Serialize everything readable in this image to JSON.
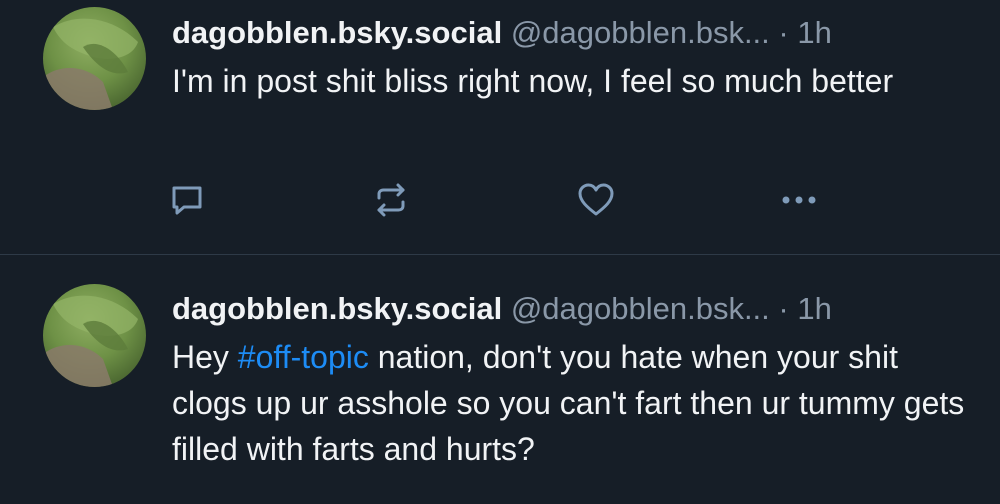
{
  "posts": [
    {
      "display_name": "dagobblen.bsky.social",
      "handle": "@dagobblen.bsk...",
      "separator": "·",
      "time": "1h",
      "text": "I'm in post shit bliss right now, I feel so much better",
      "actions": [
        "reply-icon",
        "repost-icon",
        "like-icon",
        "more-icon"
      ]
    },
    {
      "display_name": "dagobblen.bsky.social",
      "handle": "@dagobblen.bsk...",
      "separator": "·",
      "time": "1h",
      "text_before": "Hey ",
      "hashtag": "#off-topic",
      "text_after": " nation, don't you hate when your shit clogs up ur asshole so you can't fart then ur tummy gets filled with farts and hurts?"
    }
  ],
  "colors": {
    "background": "#161e27",
    "text": "#f1f3f5",
    "muted": "#8a98a8",
    "hashtag": "#1d8cf5",
    "icon": "#7f9bb9"
  }
}
